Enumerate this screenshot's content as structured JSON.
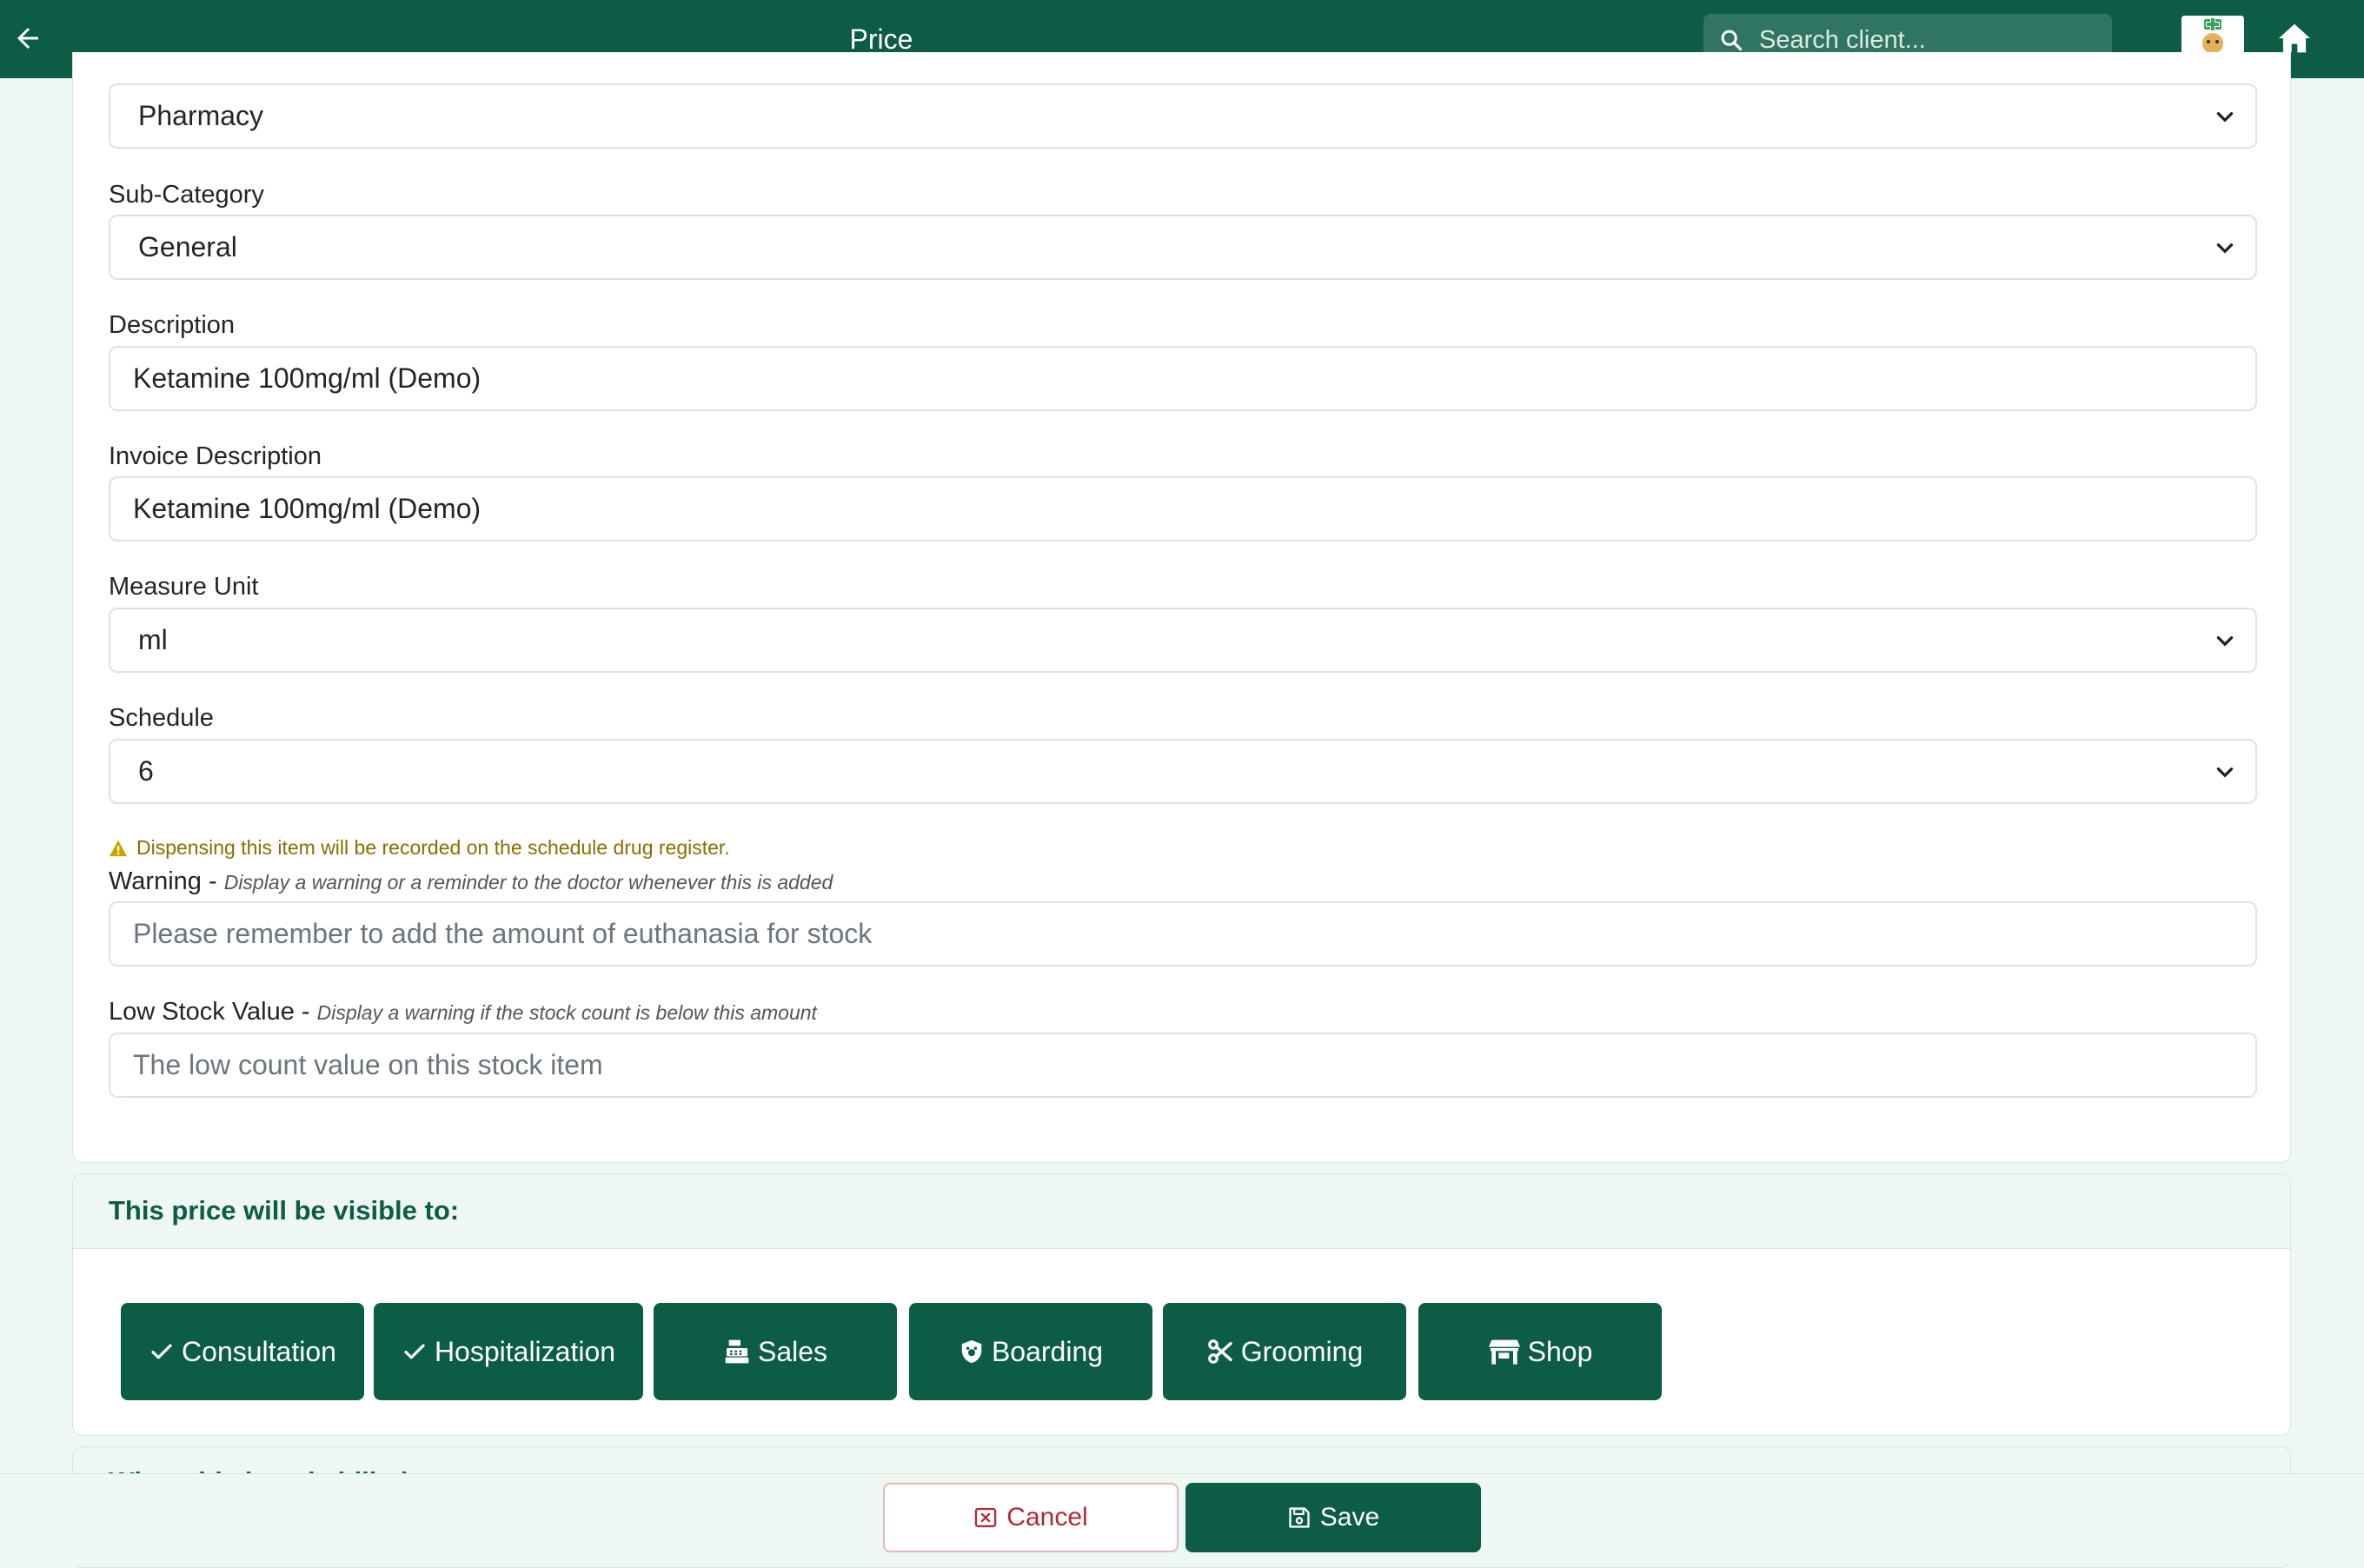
{
  "header": {
    "title": "Price",
    "search_placeholder": "Search client..."
  },
  "form": {
    "category": {
      "value": "Pharmacy"
    },
    "sub_category": {
      "label": "Sub-Category",
      "value": "General"
    },
    "description": {
      "label": "Description",
      "value": "Ketamine 100mg/ml (Demo)"
    },
    "invoice_description": {
      "label": "Invoice Description",
      "value": "Ketamine 100mg/ml (Demo)"
    },
    "measure_unit": {
      "label": "Measure Unit",
      "value": "ml"
    },
    "schedule": {
      "label": "Schedule",
      "value": "6",
      "notice": "Dispensing this item will be recorded on the schedule drug register."
    },
    "warning": {
      "label": "Warning",
      "hint": "Display a warning or a reminder to the doctor whenever this is added",
      "placeholder": "Please remember to add the amount of euthanasia for stock"
    },
    "low_stock": {
      "label": "Low Stock Value",
      "hint": "Display a warning if the stock count is below this amount",
      "placeholder": "The low count value on this stock item"
    }
  },
  "visibility": {
    "title": "This price will be visible to:",
    "buttons": [
      {
        "label": "Consultation",
        "icon": "check-icon"
      },
      {
        "label": "Hospitalization",
        "icon": "check-icon"
      },
      {
        "label": "Sales",
        "icon": "cash-register-icon"
      },
      {
        "label": "Boarding",
        "icon": "shield-icon"
      },
      {
        "label": "Grooming",
        "icon": "scissors-icon"
      },
      {
        "label": "Shop",
        "icon": "store-icon"
      }
    ]
  },
  "next_section": {
    "title": "When this item is billed"
  },
  "footer": {
    "cancel_label": "Cancel",
    "save_label": "Save"
  },
  "colors": {
    "brand": "#0c5c46",
    "background": "#eef7f2",
    "cancel": "#b02a37",
    "warning_text": "#8a6d00"
  }
}
